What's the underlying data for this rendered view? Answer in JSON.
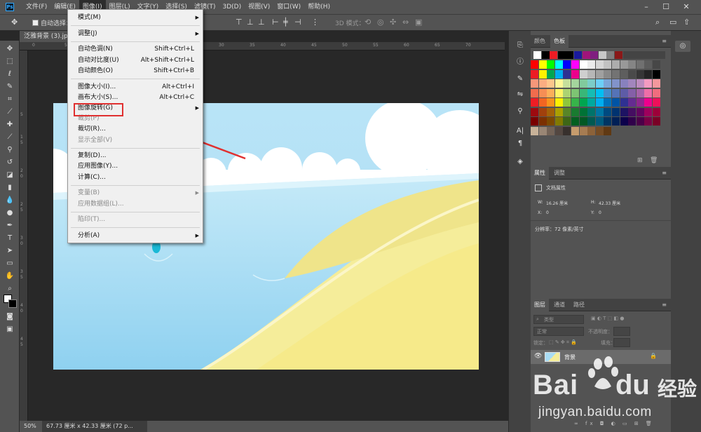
{
  "menubar": {
    "items": [
      "文件(F)",
      "编辑(E)",
      "图像(I)",
      "图层(L)",
      "文字(Y)",
      "选择(S)",
      "滤镜(T)",
      "3D(D)",
      "视图(V)",
      "窗口(W)",
      "帮助(H)"
    ],
    "active_index": 2,
    "window_controls": [
      "–",
      "☐",
      "✕"
    ]
  },
  "optionsbar": {
    "auto_select_label": "自动选择：",
    "mode_3d_label": "3D 模式："
  },
  "document": {
    "tab_title": "泛雅背景 (3).jpg @",
    "zoom": "50%",
    "status_info": "67.73 厘米 x 42.33 厘米 (72 p..."
  },
  "ruler": {
    "top_ticks": [
      "0",
      "5",
      "10",
      "15",
      "20",
      "25",
      "30",
      "35",
      "40",
      "45",
      "50",
      "55",
      "60",
      "65",
      "70"
    ],
    "left_ticks": [
      "5",
      "1",
      "5",
      "2",
      "0",
      "2",
      "5",
      "3",
      "0",
      "3",
      "5",
      "4",
      "0",
      "4",
      "5"
    ]
  },
  "image_menu": {
    "items": [
      {
        "label": "模式(M)",
        "shortcut": "",
        "submenu": true,
        "disabled": false
      },
      {
        "sep": true
      },
      {
        "label": "调整(J)",
        "shortcut": "",
        "submenu": true,
        "disabled": false
      },
      {
        "sep": true
      },
      {
        "label": "自动色调(N)",
        "shortcut": "Shift+Ctrl+L",
        "submenu": false,
        "disabled": false
      },
      {
        "label": "自动对比度(U)",
        "shortcut": "Alt+Shift+Ctrl+L",
        "submenu": false,
        "disabled": false
      },
      {
        "label": "自动颜色(O)",
        "shortcut": "Shift+Ctrl+B",
        "submenu": false,
        "disabled": false
      },
      {
        "sep": true
      },
      {
        "label": "图像大小(I)...",
        "shortcut": "Alt+Ctrl+I",
        "submenu": false,
        "disabled": false
      },
      {
        "label": "画布大小(S)...",
        "shortcut": "Alt+Ctrl+C",
        "submenu": false,
        "disabled": false
      },
      {
        "label": "图像旋转(G)",
        "shortcut": "",
        "submenu": true,
        "disabled": false
      },
      {
        "label": "裁剪(P)",
        "shortcut": "",
        "submenu": false,
        "disabled": true
      },
      {
        "label": "裁切(R)...",
        "shortcut": "",
        "submenu": false,
        "disabled": false
      },
      {
        "label": "显示全部(V)",
        "shortcut": "",
        "submenu": false,
        "disabled": true
      },
      {
        "sep": true
      },
      {
        "label": "复制(D)...",
        "shortcut": "",
        "submenu": false,
        "disabled": false
      },
      {
        "label": "应用图像(Y)...",
        "shortcut": "",
        "submenu": false,
        "disabled": false
      },
      {
        "label": "计算(C)...",
        "shortcut": "",
        "submenu": false,
        "disabled": false
      },
      {
        "sep": true
      },
      {
        "label": "变量(B)",
        "shortcut": "",
        "submenu": true,
        "disabled": true
      },
      {
        "label": "应用数据组(L)...",
        "shortcut": "",
        "submenu": false,
        "disabled": true
      },
      {
        "sep": true
      },
      {
        "label": "陷印(T)...",
        "shortcut": "",
        "submenu": false,
        "disabled": true
      },
      {
        "sep": true
      },
      {
        "label": "分析(A)",
        "shortcut": "",
        "submenu": true,
        "disabled": false
      }
    ]
  },
  "color_panel": {
    "tabs": [
      "颜色",
      "色板"
    ],
    "active_tab": 1
  },
  "swatches": {
    "row0": [
      "#ffffff",
      "#000000",
      "#ed1c24",
      "#000000",
      "#000000",
      "#1a1a9c",
      "#a0147a",
      "#7f1f7f",
      "#c8c8c8",
      "#7f7f7f",
      "#8a1818"
    ],
    "grid": [
      [
        "#ff0000",
        "#ffff00",
        "#00ff00",
        "#00ffff",
        "#0000ff",
        "#ff00ff",
        "#ffffff",
        "#ebebeb",
        "#d6d6d6",
        "#c2c2c2",
        "#adadad",
        "#999999",
        "#858585",
        "#707070",
        "#5c5c5c",
        "#474747"
      ],
      [
        "#ed1c24",
        "#fff200",
        "#00a651",
        "#00aeef",
        "#2e3192",
        "#ec008c",
        "#cfcfcf",
        "#b7b7b7",
        "#a0a0a0",
        "#898989",
        "#737373",
        "#5e5e5e",
        "#4a4a4a",
        "#363636",
        "#242424",
        "#000000"
      ],
      [
        "#f7977a",
        "#fbad82",
        "#fdc68c",
        "#fff799",
        "#c6df9c",
        "#a4d49d",
        "#81ca9d",
        "#7bcdc9",
        "#6ccff7",
        "#7ca6d8",
        "#8293ca",
        "#8881be",
        "#a286bd",
        "#bc8cbf",
        "#f49bc1",
        "#f5989d"
      ],
      [
        "#f16c4d",
        "#f68e55",
        "#fbaf5a",
        "#fff467",
        "#acd372",
        "#7dc473",
        "#39b778",
        "#16bcb4",
        "#00bff3",
        "#438ccb",
        "#5573b7",
        "#5e5ca7",
        "#855fa8",
        "#a763a9",
        "#ef6ea8",
        "#f16d7e"
      ],
      [
        "#ee1d24",
        "#f16522",
        "#f7941d",
        "#fff100",
        "#8fc63d",
        "#37b44a",
        "#00a650",
        "#00a99e",
        "#00aeef",
        "#0072bc",
        "#0054a5",
        "#2f3192",
        "#652c91",
        "#91278f",
        "#ed008c",
        "#ee105a"
      ],
      [
        "#9d0a0f",
        "#a1410d",
        "#a36209",
        "#aba000",
        "#588528",
        "#197b30",
        "#007236",
        "#00736a",
        "#0076a4",
        "#004a80",
        "#003370",
        "#1d1363",
        "#450e61",
        "#62055f",
        "#9e005c",
        "#9d0039"
      ],
      [
        "#790000",
        "#7b3000",
        "#7c4900",
        "#827a00",
        "#3e6617",
        "#045f20",
        "#005824",
        "#005951",
        "#005b7e",
        "#003562",
        "#002056",
        "#0c004b",
        "#30004a",
        "#4b0048",
        "#7a0045",
        "#7a0026"
      ],
      [
        "#c7b299",
        "#998675",
        "#736357",
        "#534741",
        "#37302d",
        "#c69c6d",
        "#a67c52",
        "#8c6239",
        "#754c24",
        "#603913",
        "",
        "",
        "",
        "",
        "",
        ""
      ]
    ]
  },
  "properties_panel": {
    "tabs": [
      "属性",
      "调整"
    ],
    "title": "文档属性",
    "w_label": "W:",
    "w_value": "16.26 厘米",
    "h_label": "H:",
    "h_value": "42.33 厘米",
    "x_label": "X:",
    "x_value": "0",
    "y_label": "Y:",
    "y_value": "0",
    "resolution": "分辨率：72 像素/英寸"
  },
  "layers_panel": {
    "tabs": [
      "图层",
      "通道",
      "路径"
    ],
    "kind_label": "类型",
    "blend_mode": "正常",
    "opacity_label": "不透明度：",
    "lock_label": "锁定：",
    "fill_label": "填充：",
    "layer_name": "背景"
  },
  "watermark": {
    "brand": "Bai",
    "brand2": "du",
    "cn": "经验",
    "url": "jingyan.baidu.com"
  },
  "colors": {
    "ui_dark": "#282828",
    "ui_panel": "#535353",
    "menu_bg": "#f0f0f0",
    "highlight_red": "#e03030",
    "sky": "#b5e3f7",
    "sand": "#f3e98f"
  }
}
